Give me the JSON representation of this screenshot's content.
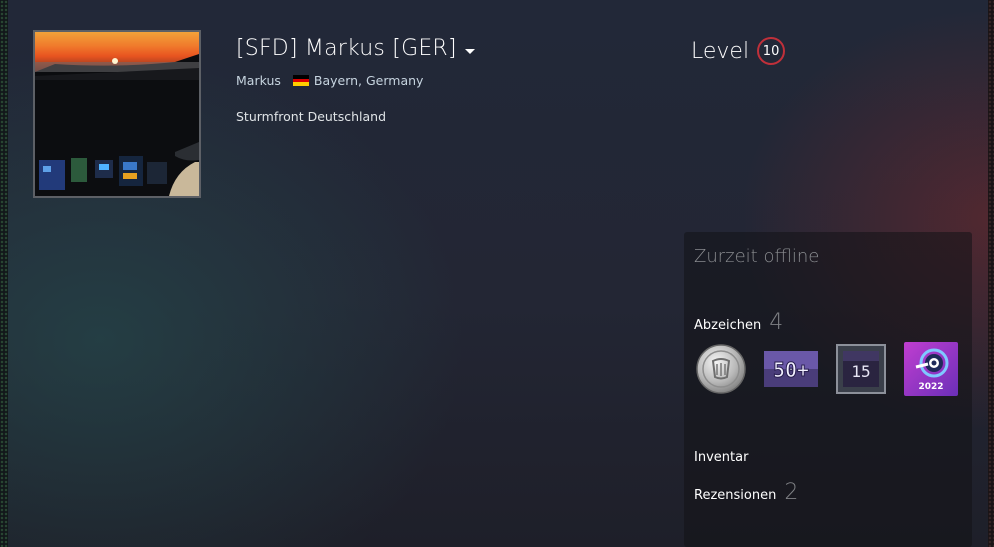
{
  "profile": {
    "persona_name": "[SFD] Markus [GER]",
    "real_name": "Markus",
    "location": "Bayern, Germany",
    "summary": "Sturmfront Deutschland",
    "flag_colors": [
      "#000000",
      "#dd0000",
      "#ffce00"
    ]
  },
  "level": {
    "label": "Level",
    "value": "10",
    "color": "#c0303a"
  },
  "sidebar": {
    "status": "Zurzeit offline",
    "badges_label": "Abzeichen",
    "badges_count": "4",
    "badges": [
      {
        "icon": "silver-coin-badge-icon",
        "text": ""
      },
      {
        "icon": "games-50-plus-badge-icon",
        "text": "50+"
      },
      {
        "icon": "years-of-service-15-badge-icon",
        "text": "15"
      },
      {
        "icon": "steam-replay-2022-badge-icon",
        "text": "2022"
      }
    ],
    "inventory_label": "Inventar",
    "reviews_label": "Rezensionen",
    "reviews_count": "2"
  }
}
